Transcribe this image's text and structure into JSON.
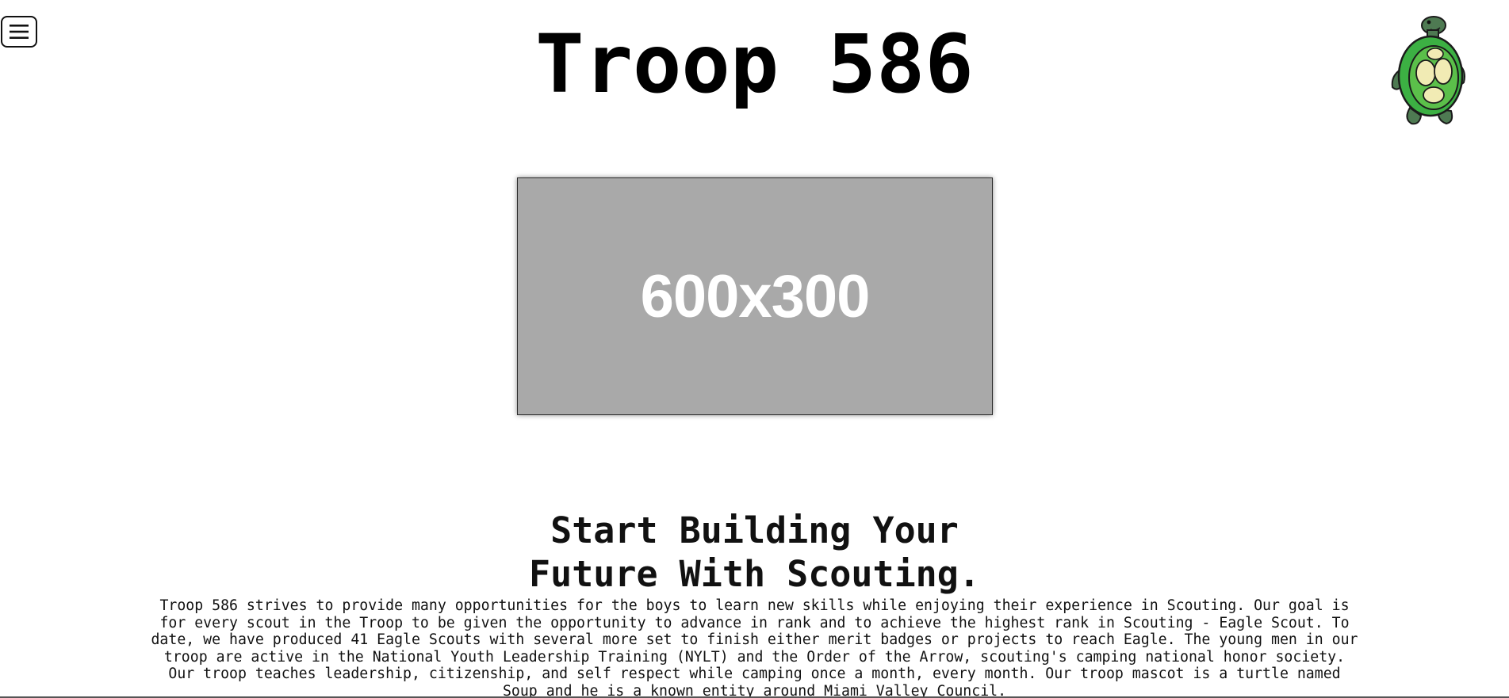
{
  "header": {
    "menu_icon": "hamburger-menu-icon",
    "title": "Troop 586",
    "mascot_icon": "turtle-mascot-icon"
  },
  "hero": {
    "placeholder_text": "600x300",
    "background_color": "#a9a9a9"
  },
  "main": {
    "headline_line1": "Start Building Your",
    "headline_line2": "Future With Scouting.",
    "intro_text": "Troop 586 strives to provide many opportunities for the boys to learn new skills while enjoying their experience in Scouting. Our goal is for every scout in the Troop to be given the opportunity to advance in rank and to achieve the highest rank in Scouting - Eagle Scout. To date, we have produced 41 Eagle Scouts with several more set to finish either merit badges or projects to reach Eagle. The young men in our troop are active in the National Youth Leadership Training (NYLT) and the Order of the Arrow, scouting's camping national honor society. Our troop teaches leadership, citizenship, and self respect while camping once a month, every month. Our troop mascot is a turtle named Soup and he is a known entity around Miami Valley Council."
  },
  "colors": {
    "turtle_green": "#3cb043",
    "turtle_dark": "#4e7a52",
    "shell_cream": "#f1ebb4"
  }
}
